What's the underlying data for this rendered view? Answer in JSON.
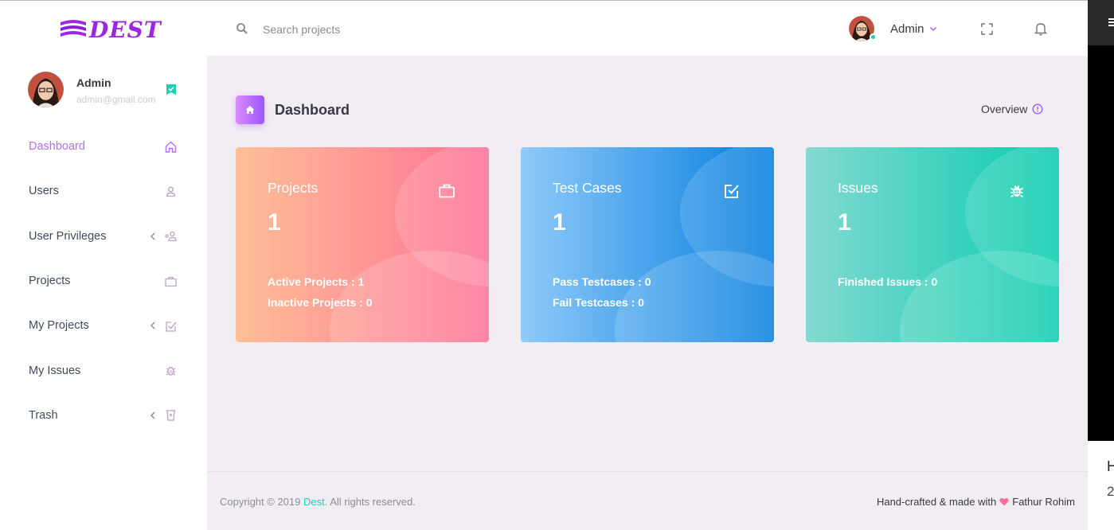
{
  "brand": {
    "logo_text": "DEST",
    "color": "#9c27e0"
  },
  "search": {
    "placeholder": "Search projects",
    "icon": "search-icon"
  },
  "topbar": {
    "user_name": "Admin",
    "status_color": "#1bcfb4"
  },
  "sidebar": {
    "profile": {
      "name": "Admin",
      "email": "admin@gmail.com"
    },
    "items": [
      {
        "label": "Dashboard",
        "icon": "home-icon",
        "active": true,
        "has_arrow": false
      },
      {
        "label": "Users",
        "icon": "user-icon",
        "active": false,
        "has_arrow": false
      },
      {
        "label": "User Privileges",
        "icon": "user-group-icon",
        "active": false,
        "has_arrow": true
      },
      {
        "label": "Projects",
        "icon": "briefcase-icon",
        "active": false,
        "has_arrow": false
      },
      {
        "label": "My Projects",
        "icon": "checklist-icon",
        "active": false,
        "has_arrow": true
      },
      {
        "label": "My Issues",
        "icon": "bug-icon",
        "active": false,
        "has_arrow": false
      },
      {
        "label": "Trash",
        "icon": "trash-icon",
        "active": false,
        "has_arrow": true
      }
    ]
  },
  "page": {
    "title": "Dashboard",
    "overview": "Overview"
  },
  "cards": [
    {
      "title": "Projects",
      "value": "1",
      "icon": "briefcase-icon",
      "lines": [
        "Active Projects : 1",
        "Inactive Projects : 0"
      ]
    },
    {
      "title": "Test Cases",
      "value": "1",
      "icon": "checklist-icon",
      "lines": [
        "Pass Testcases : 0",
        "Fail Testcases : 0"
      ]
    },
    {
      "title": "Issues",
      "value": "1",
      "icon": "bug-icon",
      "lines": [
        "Finished Issues : 0"
      ]
    }
  ],
  "footer": {
    "copyright_pre": "Copyright © 2019 ",
    "copyright_link": "Dest",
    "copyright_post": ". All rights reserved.",
    "crafted_pre": "Hand-crafted & made with",
    "crafted_author": "Fathur Rohim"
  },
  "edge": {
    "text1": "H",
    "text2": "2"
  },
  "colors": {
    "accent": "#b66dff",
    "background": "#f2edf3"
  }
}
